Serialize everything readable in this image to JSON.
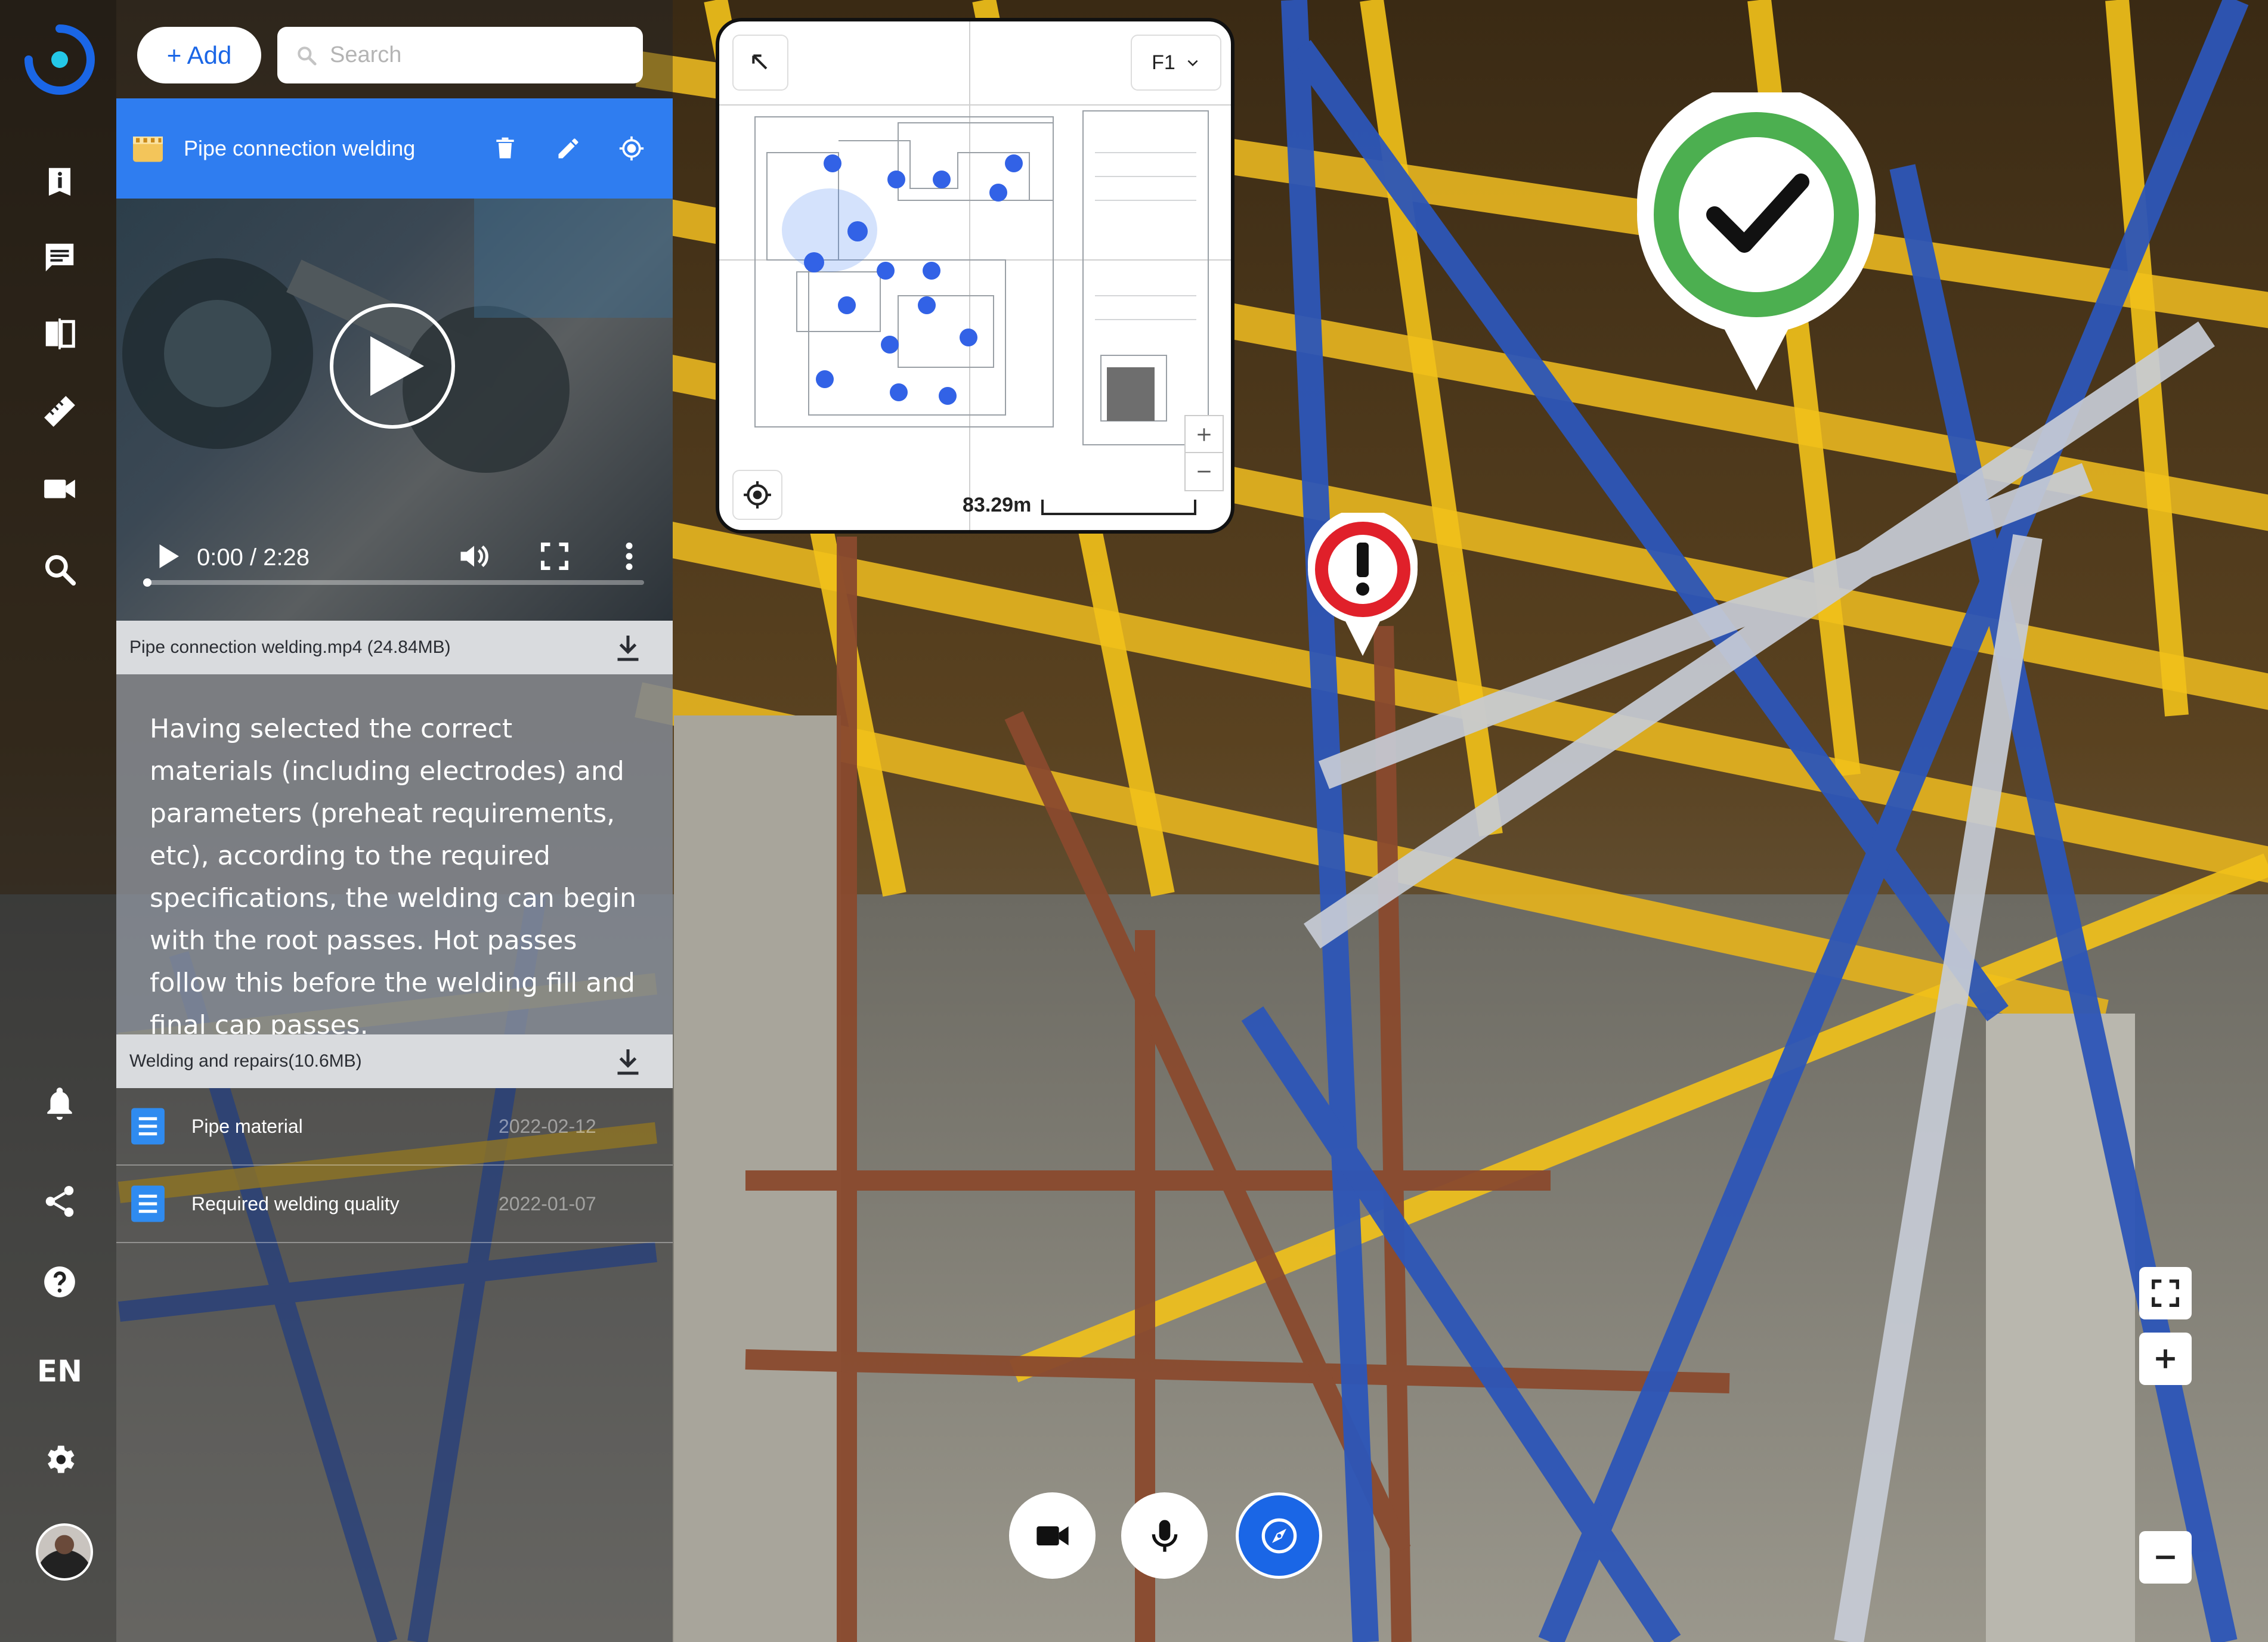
{
  "toolbar": {
    "add_label": "+ Add",
    "search_placeholder": "Search"
  },
  "item": {
    "title": "Pipe connection welding"
  },
  "video": {
    "time": "0:00 / 2:28",
    "progress": 0
  },
  "files": [
    {
      "label": "Pipe connection welding.mp4 (24.84MB)"
    },
    {
      "label": "Welding and repairs(10.6MB)"
    }
  ],
  "description": "Having selected the correct materials (including electrodes) and parameters (preheat requirements, etc), according to the required specifications, the welding can begin with the root passes. Hot passes follow this before the welding fill and final cap passes.",
  "documents": [
    {
      "name": "Pipe material",
      "date": "2022-02-12"
    },
    {
      "name": "Required welding quality",
      "date": "2022-01-07"
    }
  ],
  "sidebar": {
    "language": "EN",
    "icons": [
      "info-icon",
      "comment-icon",
      "compare-icon",
      "ruler-icon",
      "video-camera-icon",
      "search-icon",
      "bell-icon",
      "share-icon",
      "help-icon",
      "settings-icon"
    ]
  },
  "map": {
    "floor": "F1",
    "scale_label": "83.29m"
  },
  "markers": [
    {
      "type": "approved",
      "icon": "checkmark-icon",
      "color": "#4caf50"
    },
    {
      "type": "warning",
      "icon": "exclamation-icon",
      "color": "#e0202a"
    }
  ],
  "colors": {
    "accent": "#1a66e6",
    "item_header": "#2f7df0"
  }
}
